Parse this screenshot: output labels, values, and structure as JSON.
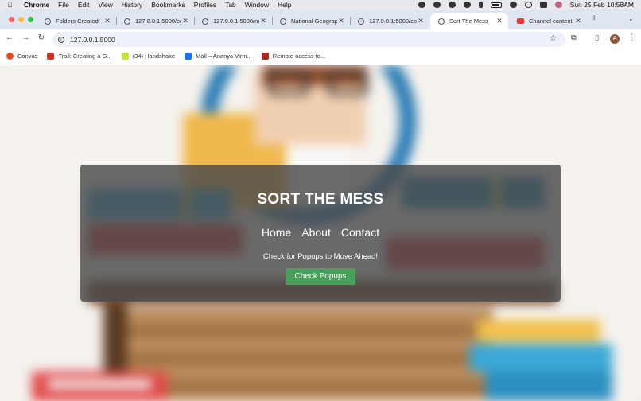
{
  "menubar": {
    "app": "Chrome",
    "items": [
      "File",
      "Edit",
      "View",
      "History",
      "Bookmarks",
      "Profiles",
      "Tab",
      "Window",
      "Help"
    ],
    "clock": "Sun 25 Feb  10:58AM"
  },
  "tabs": [
    {
      "title": "Folders Created:",
      "icon": "globe-icon"
    },
    {
      "title": "127.0.0.1:5000/co",
      "icon": "globe-icon"
    },
    {
      "title": "127.0.0.1:5000/m",
      "icon": "globe-icon"
    },
    {
      "title": "National Geograp",
      "icon": "globe-icon"
    },
    {
      "title": "127.0.0.1:5000/co",
      "icon": "globe-icon"
    },
    {
      "title": "Sort The Mess",
      "icon": "globe-icon",
      "active": true
    },
    {
      "title": "Channel content -",
      "icon": "youtube-icon"
    }
  ],
  "toolbar": {
    "url": "127.0.0.1:5000"
  },
  "bookmarks": [
    {
      "label": "Canvas",
      "color": "#e44d26"
    },
    {
      "label": "Trail: Creating a G...",
      "color": "#d93025"
    },
    {
      "label": "(34) Handshake",
      "color": "#c6e33a"
    },
    {
      "label": "Mail – Ananya Virm...",
      "color": "#1a73e8"
    },
    {
      "label": "Remote access to...",
      "color": "#b3261e"
    }
  ],
  "page": {
    "title": "SORT THE MESS",
    "nav": [
      "Home",
      "About",
      "Contact"
    ],
    "message": "Check for Popups to Move Ahead!",
    "button": "Check Popups"
  },
  "colors": {
    "accent_button": "#48a05a",
    "overlay": "rgba(75,75,75,0.82)"
  }
}
